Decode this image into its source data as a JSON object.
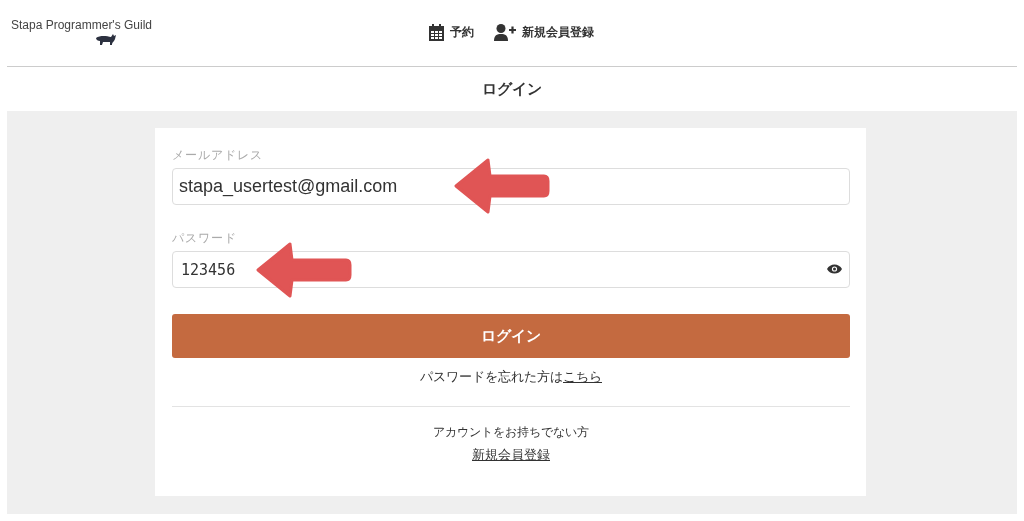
{
  "header": {
    "logo": "Stapa Programmer's Guild",
    "nav": [
      {
        "kind": "calendar",
        "label": "予約"
      },
      {
        "kind": "user-add",
        "label": "新規会員登録"
      }
    ]
  },
  "page_title": "ログイン",
  "form": {
    "email": {
      "label": "メールアドレス",
      "value": "stapa_usertest@gmail.com"
    },
    "password": {
      "label": "パスワード",
      "value": "123456"
    },
    "submit": "ログイン",
    "forgot": {
      "text": "パスワードを忘れた方は",
      "link": "こちら"
    },
    "signup": {
      "text": "アカウントをお持ちでない方",
      "link": "新規会員登録"
    }
  }
}
